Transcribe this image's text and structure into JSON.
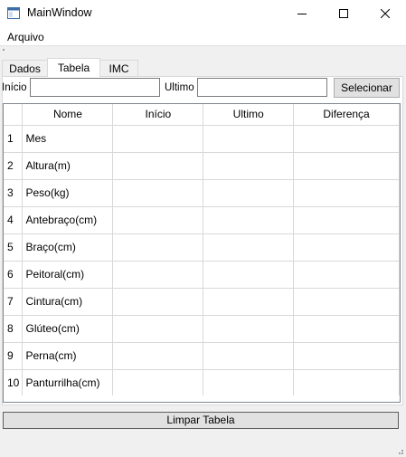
{
  "window": {
    "title": "MainWindow",
    "icon": "window-icon",
    "controls": [
      "minimize-icon",
      "maximize-icon",
      "close-icon"
    ]
  },
  "menu": {
    "items": [
      {
        "label": "Arquivo"
      }
    ]
  },
  "tabs": [
    {
      "label": "Dados",
      "active": false
    },
    {
      "label": "Tabela",
      "active": true
    },
    {
      "label": "IMC",
      "active": false
    }
  ],
  "range": {
    "inicio_label": "Início",
    "inicio_value": "",
    "ultimo_label": "Ultimo",
    "ultimo_value": "",
    "select_button": "Selecionar"
  },
  "table": {
    "columns": [
      "Nome",
      "Início",
      "Ultimo",
      "Diferença"
    ],
    "rows": [
      {
        "num": "1",
        "nome": "Mes",
        "inicio": "",
        "ultimo": "",
        "diferenca": ""
      },
      {
        "num": "2",
        "nome": "Altura(m)",
        "inicio": "",
        "ultimo": "",
        "diferenca": ""
      },
      {
        "num": "3",
        "nome": "Peso(kg)",
        "inicio": "",
        "ultimo": "",
        "diferenca": ""
      },
      {
        "num": "4",
        "nome": "Antebraço(cm)",
        "inicio": "",
        "ultimo": "",
        "diferenca": ""
      },
      {
        "num": "5",
        "nome": "Braço(cm)",
        "inicio": "",
        "ultimo": "",
        "diferenca": ""
      },
      {
        "num": "6",
        "nome": "Peitoral(cm)",
        "inicio": "",
        "ultimo": "",
        "diferenca": ""
      },
      {
        "num": "7",
        "nome": "Cintura(cm)",
        "inicio": "",
        "ultimo": "",
        "diferenca": ""
      },
      {
        "num": "8",
        "nome": "Glúteo(cm)",
        "inicio": "",
        "ultimo": "",
        "diferenca": ""
      },
      {
        "num": "9",
        "nome": "Perna(cm)",
        "inicio": "",
        "ultimo": "",
        "diferenca": ""
      },
      {
        "num": "10",
        "nome": "Panturrilha(cm)",
        "inicio": "",
        "ultimo": "",
        "diferenca": ""
      }
    ]
  },
  "actions": {
    "clear_button": "Limpar Tabela"
  },
  "colors": {
    "window_bg": "#f0f0f0",
    "button_bg": "#e1e1e1",
    "grid_line": "#d8d8d8"
  }
}
